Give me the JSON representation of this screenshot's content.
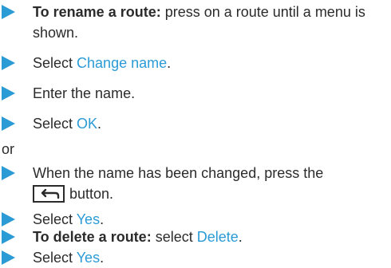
{
  "steps": [
    {
      "bold": "To rename a route:",
      "text": " press on a route until a menu is shown."
    },
    {
      "pre": "Select ",
      "menu": "Change name",
      "post": "."
    },
    {
      "text": "Enter the name."
    },
    {
      "pre": "Select ",
      "menu": "OK",
      "post": "."
    },
    {
      "or": "or"
    },
    {
      "text": "When the name has been changed, press the",
      "text2": "button."
    },
    {
      "pre": "Select ",
      "menu": "Yes",
      "post": "."
    },
    {
      "bold": "To delete a route:",
      "pre": " select ",
      "menu": "Delete",
      "post": "."
    },
    {
      "pre": "Select ",
      "menu": "Yes",
      "post": "."
    }
  ],
  "icons": {
    "arrow": "bullet-arrow-icon",
    "back": "back-arrow-icon"
  },
  "colors": {
    "accent": "#2a9bd5",
    "text": "#2b2b2b"
  }
}
